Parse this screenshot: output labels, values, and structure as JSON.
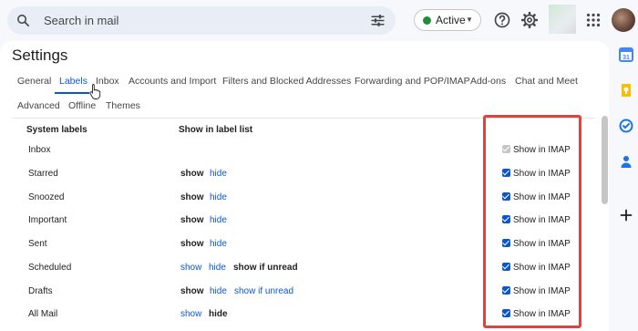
{
  "search": {
    "placeholder": "Search in mail"
  },
  "status": {
    "label": "Active",
    "color": "#1e8e3e"
  },
  "icons": {
    "search": "search-icon",
    "tune": "tune-icon",
    "help": "help-icon",
    "settings": "gear-icon",
    "apps": "apps-grid-icon"
  },
  "page": {
    "title": "Settings"
  },
  "tabs": [
    {
      "label": "General"
    },
    {
      "label": "Labels"
    },
    {
      "label": "Inbox"
    },
    {
      "label": "Accounts and Import"
    },
    {
      "label": "Filters and Blocked Addresses"
    },
    {
      "label": "Forwarding and POP/IMAP"
    },
    {
      "label": "Add-ons"
    },
    {
      "label": "Chat and Meet"
    },
    {
      "label": "Advanced"
    },
    {
      "label": "Offline"
    },
    {
      "label": "Themes"
    }
  ],
  "active_tab": "Labels",
  "table": {
    "col_labels": "System labels",
    "col_show": "Show in label list",
    "imap_label": "Show in IMAP",
    "rows": [
      {
        "name": "Inbox",
        "imap_checked": true,
        "imap_disabled": true
      },
      {
        "name": "Starred",
        "show": "show",
        "hide": "hide",
        "imap_checked": true
      },
      {
        "name": "Snoozed",
        "show": "show",
        "hide": "hide",
        "imap_checked": true
      },
      {
        "name": "Important",
        "show": "show",
        "hide": "hide",
        "imap_checked": true
      },
      {
        "name": "Sent",
        "show": "show",
        "hide": "hide",
        "imap_checked": true
      },
      {
        "name": "Scheduled",
        "show": "show",
        "hide": "hide",
        "unread": "show if unread",
        "imap_checked": true
      },
      {
        "name": "Drafts",
        "show": "show",
        "hide": "hide",
        "unread": "show if unread",
        "imap_checked": true
      },
      {
        "name": "All Mail",
        "show": "show",
        "hide": "hide",
        "imap_checked": true
      }
    ]
  },
  "highlight_color": "#e0433d",
  "accent_color": "#0b57d0"
}
